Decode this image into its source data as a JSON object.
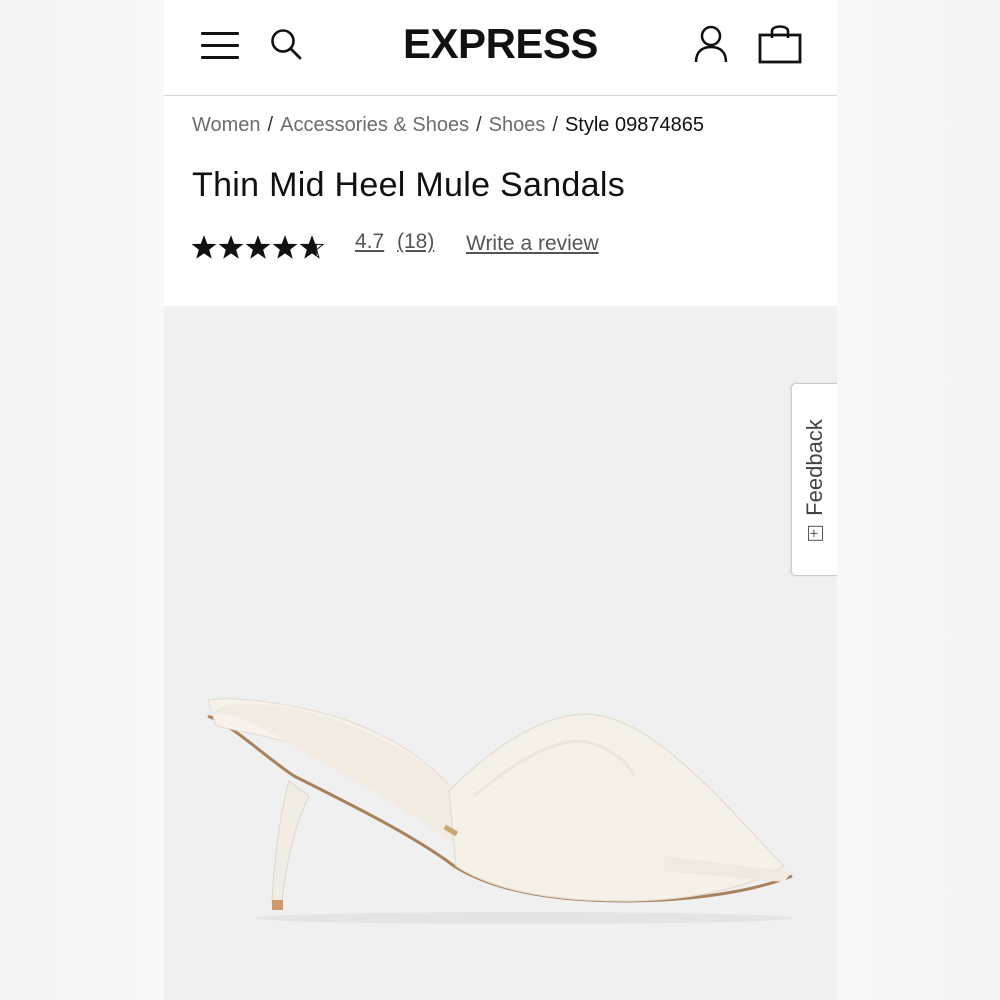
{
  "header": {
    "logo": "EXPRESS"
  },
  "breadcrumb": {
    "items": [
      "Women",
      "Accessories & Shoes",
      "Shoes"
    ],
    "separator": "/",
    "current": "Style 09874865"
  },
  "product": {
    "title": "Thin Mid Heel Mule Sandals",
    "rating": "4.7",
    "rating_fraction": 0.94,
    "review_count": "(18)",
    "write_review": "Write a review"
  },
  "feedback": {
    "label": "Feedback",
    "icon_glyph": "+"
  },
  "icons": [
    "menu-icon",
    "search-icon",
    "account-icon",
    "shopping-bag-icon",
    "star-icon"
  ],
  "colors": {
    "text": "#111111",
    "muted": "#6c6c6c",
    "image_bg": "#f0f0f0",
    "shoe": "#f3eee6"
  }
}
